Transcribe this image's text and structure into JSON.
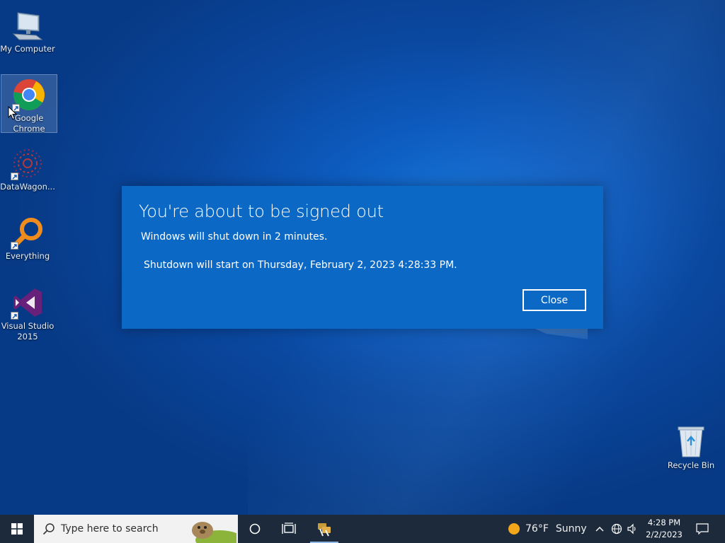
{
  "desktop": {
    "icons": [
      {
        "label": "My Computer"
      },
      {
        "label": "Google Chrome"
      },
      {
        "label": "DataWagon..."
      },
      {
        "label": "Everything"
      },
      {
        "label": "Visual Studio 2015"
      }
    ],
    "recycle_bin": {
      "label": "Recycle Bin"
    }
  },
  "dialog": {
    "title": "You're about to be signed out",
    "message": "Windows will shut down in 2 minutes.",
    "detail": "Shutdown will start on Thursday, February 2, 2023 4:28:33 PM.",
    "close_label": "Close"
  },
  "taskbar": {
    "search_placeholder": "Type here to search",
    "weather": {
      "temperature": "76°F",
      "condition": "Sunny"
    },
    "clock": {
      "time": "4:28 PM",
      "date": "2/2/2023"
    },
    "icons": [
      "windows-start-icon",
      "search-icon",
      "cortana-icon",
      "task-view-icon",
      "pinned-app-icon",
      "chevron-up-icon",
      "network-icon",
      "volume-icon",
      "notification-icon"
    ]
  },
  "colors": {
    "dialog_bg": "#0b68c5",
    "taskbar_bg": "#1c2a3c",
    "desktop_bg": "#0a479e"
  }
}
